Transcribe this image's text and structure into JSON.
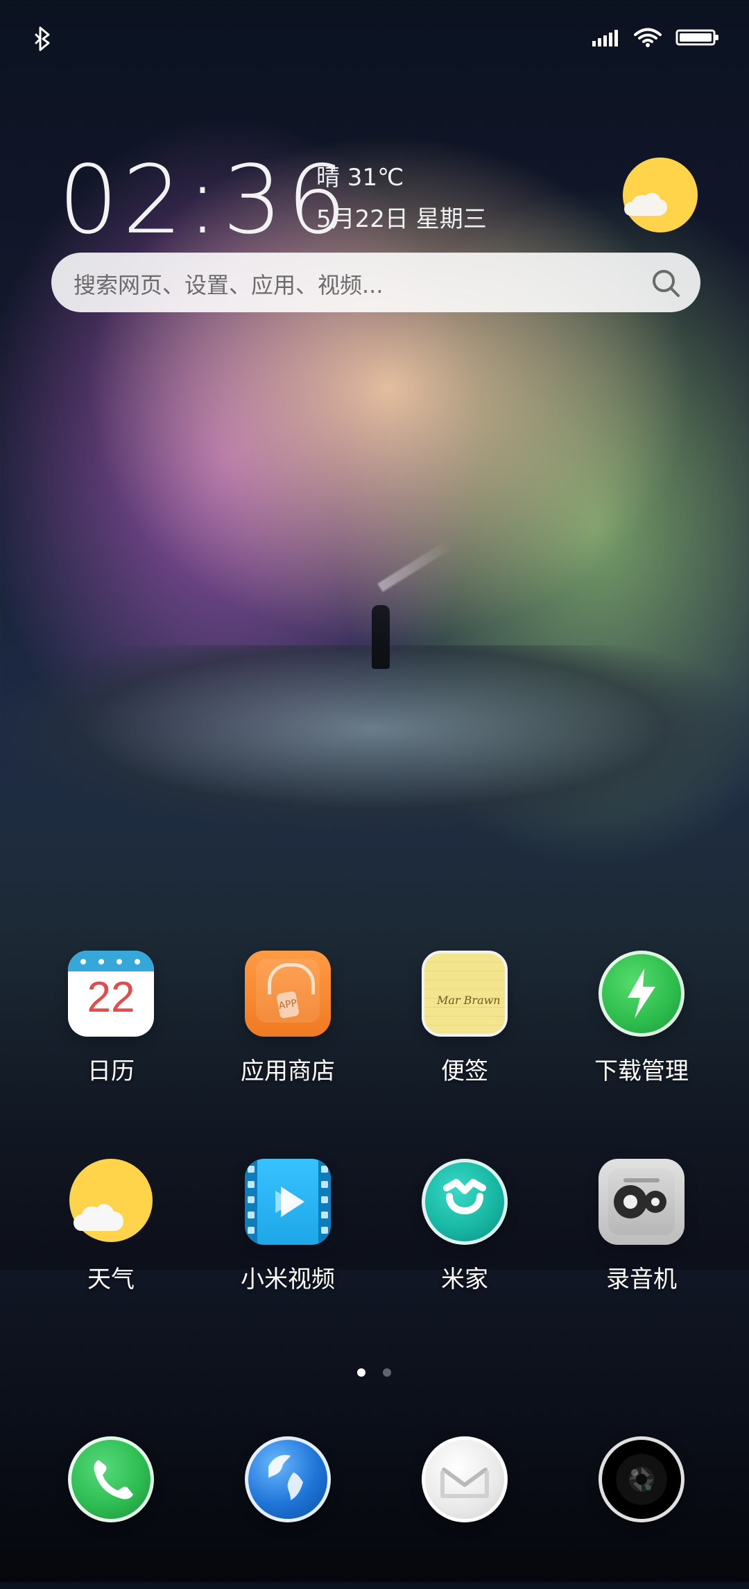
{
  "statusbar": {
    "icons": {
      "bluetooth": "bluetooth-icon",
      "signal": "signal-bars-icon",
      "wifi": "wifi-icon",
      "battery": "battery-icon"
    }
  },
  "home": {
    "time": "02:36",
    "weather": "晴 31℃",
    "date": "5月22日 星期三",
    "search_placeholder": "搜索网页、设置、应用、视频..."
  },
  "apps": [
    {
      "id": "calendar",
      "label": "日历",
      "day": "22"
    },
    {
      "id": "app-store",
      "label": "应用商店",
      "tag": "APP"
    },
    {
      "id": "notes",
      "label": "便签",
      "signature": "Mar Brawn"
    },
    {
      "id": "downloads",
      "label": "下载管理"
    },
    {
      "id": "weather",
      "label": "天气"
    },
    {
      "id": "mi-video",
      "label": "小米视频"
    },
    {
      "id": "mi-home",
      "label": "米家"
    },
    {
      "id": "recorder",
      "label": "录音机"
    }
  ],
  "page_indicator": {
    "total_pages": 2,
    "active_index": 0
  },
  "dock": [
    {
      "id": "phone"
    },
    {
      "id": "browser"
    },
    {
      "id": "mail"
    },
    {
      "id": "camera"
    }
  ],
  "colors": {
    "calendar_red": "#e64b4b",
    "store_orange": "#f07a22",
    "note_yellow": "#f3e48e",
    "download_green": "#2fbf4e",
    "weather_sun": "#ffd34a",
    "video_blue": "#1ea7e8",
    "mihome_teal": "#18b8a5",
    "recorder_gray": "#bdbdbd",
    "phone_green": "#2ebd52",
    "globe_blue": "#1e74d6",
    "mail_white": "#f3f3f3"
  }
}
